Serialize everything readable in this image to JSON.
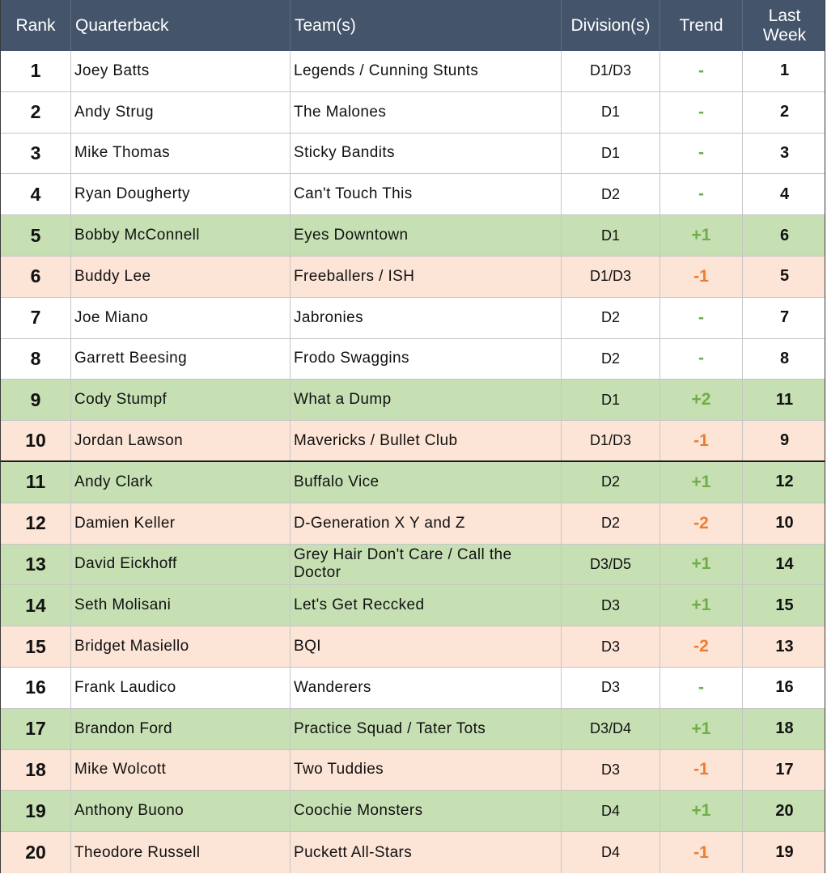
{
  "header": {
    "rank": "Rank",
    "quarterback": "Quarterback",
    "teams": "Team(s)",
    "divisions": "Division(s)",
    "trend": "Trend",
    "last_week_1": "Last",
    "last_week_2": "Week"
  },
  "colors": {
    "header_bg": "#44546a",
    "up_row": "#c6e0b4",
    "down_row": "#fce4d6",
    "trend_up": "#70ad47",
    "trend_down": "#ed7d31"
  },
  "rows": [
    {
      "rank": "1",
      "qb": "Joey Batts",
      "team": "Legends / Cunning Stunts",
      "div": "D1/D3",
      "trend": "-",
      "last": "1",
      "dir": "none"
    },
    {
      "rank": "2",
      "qb": "Andy Strug",
      "team": "The Malones",
      "div": "D1",
      "trend": "-",
      "last": "2",
      "dir": "none"
    },
    {
      "rank": "3",
      "qb": "Mike Thomas",
      "team": "Sticky Bandits",
      "div": "D1",
      "trend": "-",
      "last": "3",
      "dir": "none"
    },
    {
      "rank": "4",
      "qb": "Ryan Dougherty",
      "team": "Can't Touch This",
      "div": "D2",
      "trend": "-",
      "last": "4",
      "dir": "none"
    },
    {
      "rank": "5",
      "qb": "Bobby McConnell",
      "team": "Eyes Downtown",
      "div": "D1",
      "trend": "+1",
      "last": "6",
      "dir": "up"
    },
    {
      "rank": "6",
      "qb": "Buddy Lee",
      "team": "Freeballers / ISH",
      "div": "D1/D3",
      "trend": "-1",
      "last": "5",
      "dir": "down"
    },
    {
      "rank": "7",
      "qb": "Joe Miano",
      "team": "Jabronies",
      "div": "D2",
      "trend": "-",
      "last": "7",
      "dir": "none"
    },
    {
      "rank": "8",
      "qb": "Garrett Beesing",
      "team": "Frodo Swaggins",
      "div": "D2",
      "trend": "-",
      "last": "8",
      "dir": "none"
    },
    {
      "rank": "9",
      "qb": "Cody Stumpf",
      "team": "What a Dump",
      "div": "D1",
      "trend": "+2",
      "last": "11",
      "dir": "up"
    },
    {
      "rank": "10",
      "qb": "Jordan Lawson",
      "team": "Mavericks / Bullet Club",
      "div": "D1/D3",
      "trend": "-1",
      "last": "9",
      "dir": "down"
    },
    {
      "rank": "11",
      "qb": "Andy Clark",
      "team": "Buffalo Vice",
      "div": "D2",
      "trend": "+1",
      "last": "12",
      "dir": "up"
    },
    {
      "rank": "12",
      "qb": "Damien Keller",
      "team": "D-Generation X Y and Z",
      "div": "D2",
      "trend": "-2",
      "last": "10",
      "dir": "down"
    },
    {
      "rank": "13",
      "qb": "David Eickhoff",
      "team": "Grey Hair Don't Care / Call the Doctor",
      "div": "D3/D5",
      "trend": "+1",
      "last": "14",
      "dir": "up"
    },
    {
      "rank": "14",
      "qb": "Seth Molisani",
      "team": "Let's Get Reccked",
      "div": "D3",
      "trend": "+1",
      "last": "15",
      "dir": "up"
    },
    {
      "rank": "15",
      "qb": "Bridget Masiello",
      "team": "BQI",
      "div": "D3",
      "trend": "-2",
      "last": "13",
      "dir": "down"
    },
    {
      "rank": "16",
      "qb": "Frank Laudico",
      "team": "Wanderers",
      "div": "D3",
      "trend": "-",
      "last": "16",
      "dir": "none"
    },
    {
      "rank": "17",
      "qb": "Brandon Ford",
      "team": "Practice Squad / Tater Tots",
      "div": "D3/D4",
      "trend": "+1",
      "last": "18",
      "dir": "up"
    },
    {
      "rank": "18",
      "qb": "Mike Wolcott",
      "team": "Two Tuddies",
      "div": "D3",
      "trend": "-1",
      "last": "17",
      "dir": "down"
    },
    {
      "rank": "19",
      "qb": "Anthony Buono",
      "team": "Coochie Monsters",
      "div": "D4",
      "trend": "+1",
      "last": "20",
      "dir": "up"
    },
    {
      "rank": "20",
      "qb": "Theodore Russell",
      "team": "Puckett All-Stars",
      "div": "D4",
      "trend": "-1",
      "last": "19",
      "dir": "down"
    }
  ]
}
